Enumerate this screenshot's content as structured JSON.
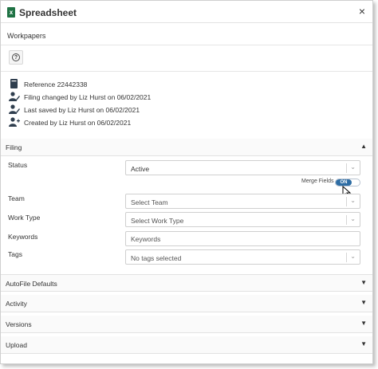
{
  "window": {
    "title": "Spreadsheet",
    "close_glyph": "×"
  },
  "subtitle": "Workpapers",
  "help_button": {
    "icon": "help-circle-icon",
    "glyph": "?"
  },
  "info": {
    "reference": "Reference 22442338",
    "filing_changed": "Filing changed by Liz Hurst on 06/02/2021",
    "last_saved": "Last saved by Liz Hurst on 06/02/2021",
    "created": "Created by Liz Hurst on 06/02/2021"
  },
  "filing": {
    "header": "Filing",
    "status_label": "Status",
    "status_value": "Active",
    "merge_fields_label": "Merge Fields",
    "merge_fields_toggle": "ON",
    "team_label": "Team",
    "team_placeholder": "Select Team",
    "work_type_label": "Work Type",
    "work_type_placeholder": "Select Work Type",
    "keywords_label": "Keywords",
    "keywords_placeholder": "Keywords",
    "tags_label": "Tags",
    "tags_placeholder": "No tags selected"
  },
  "sections": {
    "autofile": "AutoFile Defaults",
    "activity": "Activity",
    "versions": "Versions",
    "upload": "Upload"
  },
  "colors": {
    "accent": "#2e6da4",
    "excel_green": "#1f7244"
  }
}
